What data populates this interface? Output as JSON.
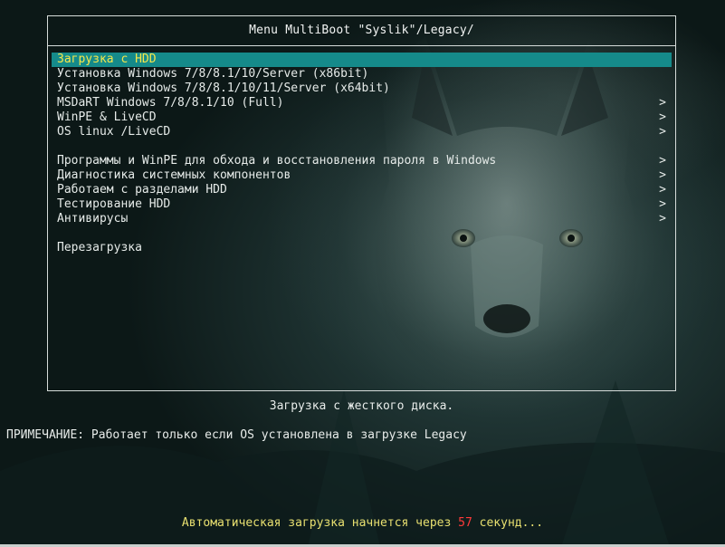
{
  "menu": {
    "title": "Menu MultiBoot \"Syslik\"/Legacy/",
    "items": [
      {
        "label": "Загрузка с HDD",
        "submenu": false
      },
      {
        "label": "Установка Windows 7/8/8.1/10/Server (x86bit)",
        "submenu": false
      },
      {
        "label": "Установка Windows 7/8/8.1/10/11/Server (x64bit)",
        "submenu": false
      },
      {
        "label": "MSDaRT Windows 7/8/8.1/10 (Full)",
        "submenu": true
      },
      {
        "label": "WinPE & LiveCD",
        "submenu": true
      },
      {
        "label": "OS linux /LiveCD",
        "submenu": true
      },
      {
        "label": "Программы и WinPE для обхода и восстановления пароля в Windows",
        "submenu": true
      },
      {
        "label": "Диагностика системных компонентов",
        "submenu": true
      },
      {
        "label": "Работаем с разделами HDD",
        "submenu": true
      },
      {
        "label": "Тестирование HDD",
        "submenu": true
      },
      {
        "label": "Антивирусы",
        "submenu": true
      },
      {
        "label": "Перезагрузка",
        "submenu": false
      }
    ],
    "submenu_arrow": ">",
    "selected_index": 0
  },
  "description": "Загрузка с жесткого диска.",
  "note": "ПРИМЕЧАНИЕ: Работает только если OS установлена в загрузке Legacy",
  "countdown": {
    "prefix": "Автоматическая загрузка начнется через ",
    "seconds": "57",
    "suffix": " секунд..."
  },
  "colors": {
    "selected_bg": "#158a8a",
    "selected_text": "#f5e64a",
    "countdown_text": "#e8e070",
    "countdown_seconds": "#ff3a3a"
  }
}
